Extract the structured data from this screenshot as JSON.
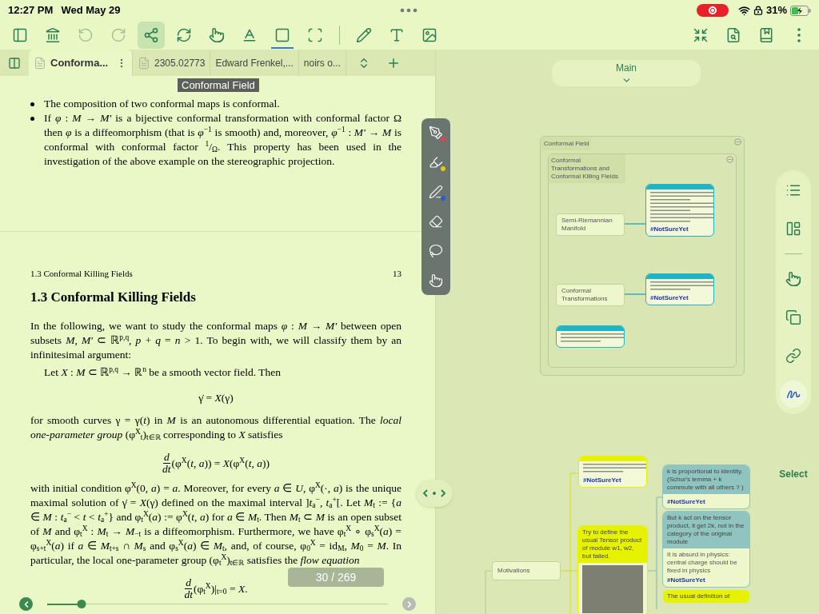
{
  "status_bar": {
    "time": "12:27 PM",
    "date": "Wed May 29",
    "recording": true,
    "battery": "31%"
  },
  "toolbar": {
    "left": [
      {
        "selected": false,
        "active": false,
        "disabled": false
      },
      {
        "selected": false,
        "active": false,
        "disabled": false
      },
      {
        "selected": false,
        "active": false,
        "disabled": true
      },
      {
        "selected": false,
        "active": false,
        "disabled": true
      },
      {
        "selected": true,
        "active": false,
        "disabled": false
      },
      {
        "selected": false,
        "active": false,
        "disabled": false
      },
      {
        "selected": false,
        "active": false,
        "disabled": false
      },
      {
        "selected": false,
        "active": false,
        "disabled": false
      },
      {
        "selected": false,
        "active": true,
        "disabled": false
      },
      {
        "selected": false,
        "active": false,
        "disabled": false
      },
      {
        "selected": false,
        "active": false,
        "disabled": false
      },
      {
        "selected": false,
        "active": false,
        "disabled": false
      },
      {
        "selected": false,
        "active": false,
        "disabled": false
      }
    ],
    "right": [
      {
        "selected": false,
        "active": false,
        "disabled": false
      },
      {
        "selected": false,
        "active": false,
        "disabled": false
      },
      {
        "selected": false,
        "active": false,
        "disabled": false
      },
      {
        "selected": false,
        "active": false,
        "disabled": false
      }
    ]
  },
  "tabs": [
    {
      "label": "Conforma...",
      "selected": true
    },
    {
      "label": "2305.02773",
      "selected": false
    },
    {
      "label": "Edward Frenkel,...",
      "selected": false
    },
    {
      "label": "noirs o...",
      "selected": false
    }
  ],
  "document": {
    "tooltip": "Conformal Field",
    "bullets": [
      "The composition of two conformal maps is conformal.",
      "If *φ* : *M* → *M′* is a bijective conformal transformation with conformal factor Ω then *φ* is a diffeomorphism (that is *φ*$^{−1}$ is smooth) and, moreover, *φ*$^{−1}$ : *M′* → *M* is conformal with conformal factor $^{1}$/$_{Ω}$. This property has been used in the investigation of the above example on the stereographic projection."
    ],
    "page_header": {
      "section": "1.3  Conformal Killing Fields",
      "page": "13"
    },
    "heading": "1.3  Conformal Killing Fields",
    "blocks": [
      {
        "kind": "paragraph",
        "text": "In the following, we want to study the conformal maps *φ* : *M* → *M′* between open subsets *M*, *M′* ⊂ ℝ$^{p,q}$, *p* + *q* = *n* > 1. To begin with, we will classify them by an infinitesimal argument:"
      },
      {
        "kind": "indent",
        "text": "Let *X* : *M* ⊂ ℝ$^{p,q}$ → ℝ$^{n}$ be a smooth vector field. Then"
      },
      {
        "kind": "equation",
        "text": "γ̇ = *X*(γ)"
      },
      {
        "kind": "paragraph",
        "text": "for smooth curves γ = γ(*t*) in *M* is an autonomous differential equation. The *local one-parameter group* (φ$^{X}$$_{t}$)$_{t∈ℝ}$ corresponding to *X* satisfies"
      },
      {
        "kind": "fraction",
        "num": "d",
        "den": "dt",
        "text": "(φ$^{X}$(*t*, *a*)) = *X*(φ$^{X}$(*t*, *a*))"
      },
      {
        "kind": "paragraph",
        "text": "with initial condition φ$^{X}$(0, *a*) = *a*. Moreover, for every *a* ∈ *U*, φ$^{X}$(·, *a*) is the unique maximal solution of γ̇ = *X*(γ) defined on the maximal interval ]*t*$_{a}$$^{−}$, *t*$_{a}$$^{+}$[. Let *M*$_{t}$ := {*a* ∈ *M* : *t*$_{a}$$^{−}$ < *t* < *t*$_{a}$$^{+}$} and φ$_{t}$$^{X}$(*a*) := φ$^{X}$(*t*, *a*) for *a* ∈ *M*$_{t}$. Then *M*$_{t}$ ⊂ *M* is an open subset of *M* and φ$_{t}$$^{X}$ : *M*$_{t}$ → *M*$_{−t}$ is a diffeomorphism. Furthermore, we have φ$_{t}$$^{X}$ ∘ φ$_{s}$$^{X}$(*a*) = φ$_{s+t}$$^{X}$(*a*) if *a* ∈ *M*$_{t+s}$ ∩ *M*$_{s}$ and φ$_{s}$$^{X}$(*a*) ∈ *M*$_{t}$, and, of course, φ$_{0}$$^{X}$ = id$_{M}$, *M*$_{0}$ = *M*. In particular, the local one-parameter group (φ$_{t}$$^{X}$)$_{t∈ℝ}$ satisfies the *flow equation*"
      },
      {
        "kind": "fraction",
        "num": "d",
        "den": "dt",
        "text": "(φ$_{t}$$^{X}$)|$_{t=0}$ = *X*."
      }
    ],
    "page_indicator": "30 / 269",
    "slider": {
      "level": 0.1
    }
  },
  "pen_colors": [
    {
      "color": "#e0474c"
    },
    {
      "color": "#e6c80a"
    },
    {
      "color": "#2a5bd7"
    }
  ],
  "mindmap": {
    "title": "Main",
    "group": {
      "title": "Conformal Field",
      "inner_title": "Conformal Transformations and Conformal Killing Fields"
    },
    "topics": [
      "Semi-Riemannian Manifold",
      "Conformal Transformations",
      "Motivations"
    ],
    "notes": [
      {
        "kind": "thumbnail",
        "color": "#1fb5c5",
        "tag": "#NotSureYet"
      },
      {
        "kind": "thumbnail",
        "color": "#1fb5c5",
        "tag": "#NotSureYet"
      },
      {
        "kind": "thumbnail",
        "color": "#1fb5c5"
      },
      {
        "kind": "thumbnail",
        "color": "#e6f200",
        "tag": "#NotSureYet"
      },
      {
        "kind": "text",
        "color": "#e6f200",
        "text": "Try to define the usual Tensor product of module w1, w2, but failed.",
        "photo": true
      },
      {
        "kind": "text",
        "color": "#8fc4c0",
        "text": "k is proportional to identity. (Schur's lemma + k commute with all others ? )",
        "tag": "#NotSureYet"
      },
      {
        "kind": "text",
        "color": "#8fc4c0",
        "text": "But k act on the tensor product, it get 2k, not in the category of the original module",
        "comment": "It is absurd in physics: central charge should be fixed in physics",
        "tag": "#NotSureYet"
      },
      {
        "kind": "text",
        "color": "#e6f200",
        "text": "The usual definition of"
      }
    ]
  },
  "side_tools": [
    {
      "selected": false
    },
    {
      "selected": false
    },
    {
      "selected": false
    },
    {
      "selected": false
    },
    {
      "selected": false
    },
    {
      "selected": true
    }
  ],
  "select_button": "Select"
}
